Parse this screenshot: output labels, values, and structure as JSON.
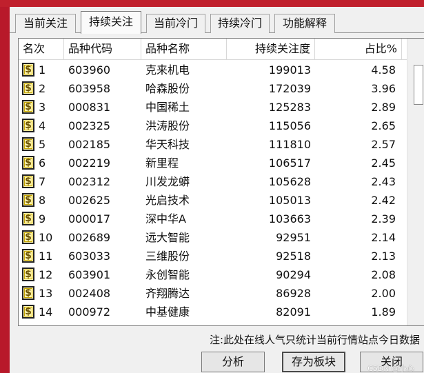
{
  "tabs": [
    {
      "label": "当前关注",
      "active": false
    },
    {
      "label": "持续关注",
      "active": true
    },
    {
      "label": "当前冷门",
      "active": false
    },
    {
      "label": "持续冷门",
      "active": false
    },
    {
      "label": "功能解释",
      "active": false
    }
  ],
  "table": {
    "headers": [
      "名次",
      "品种代码",
      "品种名称",
      "持续关注度",
      "占比%"
    ],
    "rows": [
      {
        "rank": "1",
        "code": "603960",
        "name": "克来机电",
        "attention": "199013",
        "ratio": "4.58"
      },
      {
        "rank": "2",
        "code": "603958",
        "name": "哈森股份",
        "attention": "172039",
        "ratio": "3.96"
      },
      {
        "rank": "3",
        "code": "000831",
        "name": "中国稀土",
        "attention": "125283",
        "ratio": "2.89"
      },
      {
        "rank": "4",
        "code": "002325",
        "name": "洪涛股份",
        "attention": "115056",
        "ratio": "2.65"
      },
      {
        "rank": "5",
        "code": "002185",
        "name": "华天科技",
        "attention": "111810",
        "ratio": "2.57"
      },
      {
        "rank": "6",
        "code": "002219",
        "name": "新里程",
        "attention": "106517",
        "ratio": "2.45"
      },
      {
        "rank": "7",
        "code": "002312",
        "name": "川发龙蟒",
        "attention": "105628",
        "ratio": "2.43"
      },
      {
        "rank": "8",
        "code": "002625",
        "name": "光启技术",
        "attention": "105013",
        "ratio": "2.42"
      },
      {
        "rank": "9",
        "code": "000017",
        "name": "深中华A",
        "attention": "103663",
        "ratio": "2.39"
      },
      {
        "rank": "10",
        "code": "002689",
        "name": "远大智能",
        "attention": "92951",
        "ratio": "2.14"
      },
      {
        "rank": "11",
        "code": "603033",
        "name": "三维股份",
        "attention": "92518",
        "ratio": "2.13"
      },
      {
        "rank": "12",
        "code": "603901",
        "name": "永创智能",
        "attention": "90294",
        "ratio": "2.08"
      },
      {
        "rank": "13",
        "code": "002408",
        "name": "齐翔腾达",
        "attention": "86928",
        "ratio": "2.00"
      },
      {
        "rank": "14",
        "code": "000972",
        "name": "中基健康",
        "attention": "82091",
        "ratio": "1.89"
      }
    ],
    "row_icon": "dollar-icon"
  },
  "note": "注:此处在线人气只统计当前行情站点今日数据",
  "buttons": {
    "analyze": "分析",
    "save_block": "存为板块",
    "close": "关闭"
  },
  "watermark": "CSDN @小心",
  "colors": {
    "title_bar": "#b8192a",
    "dialog_bg": "#f0f0f0"
  }
}
